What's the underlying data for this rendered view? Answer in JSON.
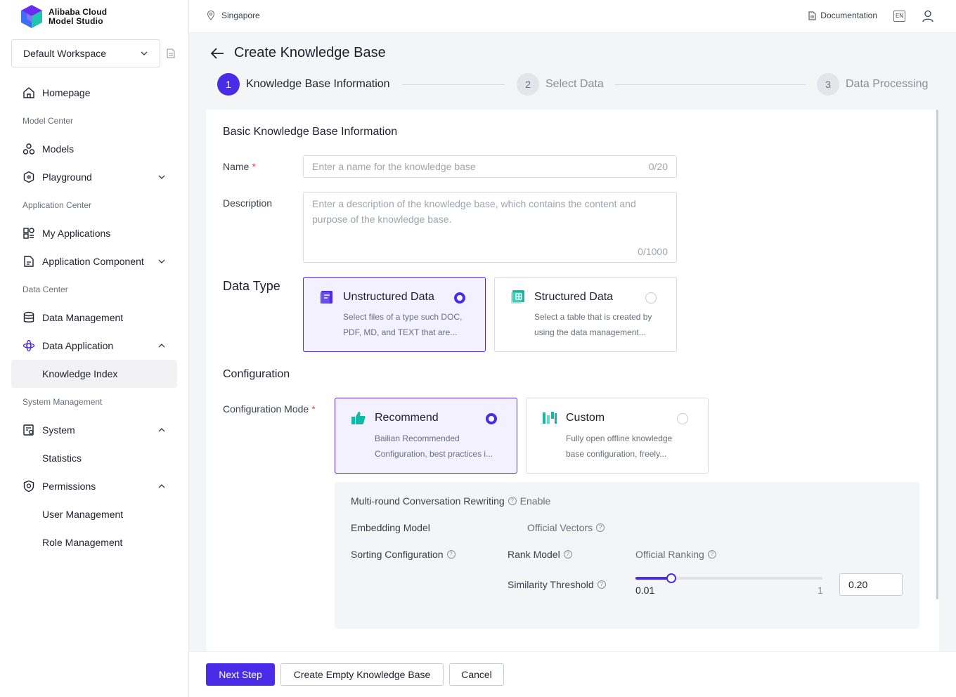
{
  "brand": {
    "line1": "Alibaba Cloud",
    "line2": "Model Studio"
  },
  "workspace": {
    "selected": "Default Workspace"
  },
  "sidebar": {
    "homepage": "Homepage",
    "group_model_center": "Model Center",
    "models": "Models",
    "playground": "Playground",
    "group_application_center": "Application Center",
    "my_applications": "My Applications",
    "application_component": "Application Component",
    "group_data_center": "Data Center",
    "data_management": "Data Management",
    "data_application": "Data Application",
    "knowledge_index": "Knowledge Index",
    "group_system_management": "System Management",
    "system": "System",
    "statistics": "Statistics",
    "permissions": "Permissions",
    "user_management": "User Management",
    "role_management": "Role Management"
  },
  "topbar": {
    "region": "Singapore",
    "documentation": "Documentation",
    "language": "EN"
  },
  "page": {
    "title": "Create Knowledge Base"
  },
  "steps": [
    {
      "number": "1",
      "label": "Knowledge Base Information",
      "state": "active"
    },
    {
      "number": "2",
      "label": "Select Data",
      "state": "pending"
    },
    {
      "number": "3",
      "label": "Data Processing",
      "state": "pending"
    }
  ],
  "form": {
    "section_basic": "Basic Knowledge Base Information",
    "name_label": "Name",
    "name_placeholder": "Enter a name for the knowledge base",
    "name_count": "0/20",
    "description_label": "Description",
    "description_placeholder": "Enter a description of the knowledge base, which contains the content and purpose of the knowledge base.",
    "description_count": "0/1000",
    "data_type_label": "Data Type",
    "data_types": [
      {
        "title": "Unstructured Data",
        "desc_line1": "Select files of a type such DOC,",
        "desc_line2": "PDF, MD, and TEXT that are...",
        "selected": true
      },
      {
        "title": "Structured Data",
        "desc_line1": "Select a table that is created by",
        "desc_line2": "using the data management...",
        "selected": false
      }
    ],
    "section_configuration": "Configuration",
    "config_mode_label": "Configuration Mode",
    "config_modes": [
      {
        "title": "Recommend",
        "desc_line1": "Bailian Recommended",
        "desc_line2": "Configuration, best practices i...",
        "selected": true
      },
      {
        "title": "Custom",
        "desc_line1": "Fully open offline knowledge",
        "desc_line2": "base configuration, freely...",
        "selected": false
      }
    ],
    "recommend": {
      "rewriting_label": "Multi-round Conversation Rewriting",
      "rewriting_value": "Enable",
      "embedding_label": "Embedding Model",
      "embedding_value": "Official Vectors",
      "sorting_label": "Sorting Configuration",
      "rank_model_label": "Rank Model",
      "rank_model_value": "Official Ranking",
      "similarity_label": "Similarity Threshold",
      "slider_min": "0.01",
      "slider_max": "1",
      "slider_value": 0.2,
      "threshold_value": "0.20"
    }
  },
  "footer": {
    "next": "Next Step",
    "create_empty": "Create Empty Knowledge Base",
    "cancel": "Cancel"
  },
  "colors": {
    "accent": "#4a2ce8",
    "teal": "#13b8a6",
    "required": "#e5484d"
  }
}
